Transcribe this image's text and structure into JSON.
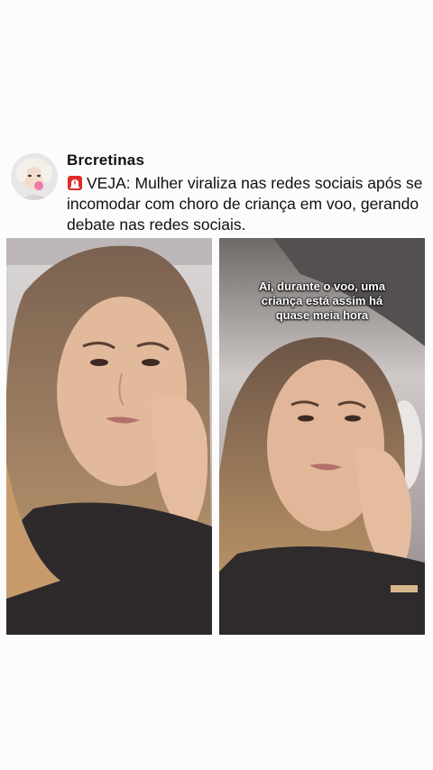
{
  "post": {
    "author": "Brcretinas",
    "avatar_icon": "profile-avatar",
    "alert_icon": "rotating-light-icon",
    "caption": "VEJA: Mulher viraliza nas redes sociais após se incomodar com choro de criança em voo, gerando debate nas redes sociais.",
    "images": [
      {
        "name": "photo-left",
        "subtitle_lines": []
      },
      {
        "name": "photo-right",
        "subtitle_lines": [
          "Ai, durante o voo, uma",
          "criança está assim há",
          "quase meia hora"
        ]
      }
    ]
  }
}
